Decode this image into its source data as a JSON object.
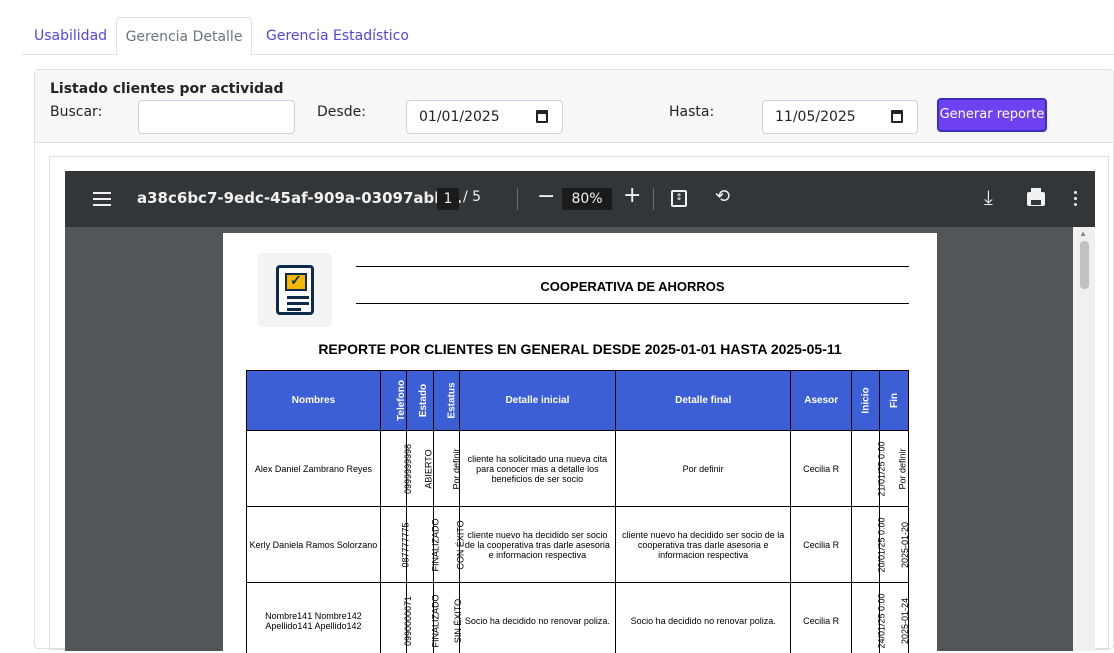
{
  "tabs": [
    {
      "label": "Usabilidad",
      "active": false
    },
    {
      "label": "Gerencia Detalle",
      "active": true
    },
    {
      "label": "Gerencia Estadístico",
      "active": false
    }
  ],
  "filter": {
    "title": "Listado clientes por actividad",
    "search_label": "Buscar:",
    "search_value": "",
    "from_label": "Desde:",
    "from_value": "01/01/2025",
    "to_label": "Hasta:",
    "to_value": "11/05/2025",
    "generate_button": "Generar reporte"
  },
  "pdf_viewer": {
    "doc_name": "a38c6bc7-9edc-45af-909a-03097abb...",
    "current_page": "1",
    "page_total": "/ 5",
    "zoom": "80%"
  },
  "report": {
    "org_name": "COOPERATIVA DE AHORROS",
    "title": "REPORTE POR CLIENTES EN GENERAL DESDE 2025-01-01 HASTA 2025-05-11",
    "columns": {
      "nombres": "Nombres",
      "telefono": "Telefono",
      "estado": "Estado",
      "estatus": "Estatus",
      "detalle_inicial": "Detalle inicial",
      "detalle_final": "Detalle final",
      "asesor": "Asesor",
      "inicio": "Inicio",
      "fin": "Fin"
    },
    "rows": [
      {
        "nombres": "Alex Daniel Zambrano Reyes",
        "telefono": "0999999998",
        "estado": "ABIERTO",
        "estatus": "Por definir",
        "detalle_inicial": "cliente ha solicitado una nueva cita para conocer mas a detalle los beneficios de ser socio",
        "detalle_final": "Por definir",
        "asesor": "Cecilia R",
        "inicio": "21/01/25 0:00",
        "fin": "Por definir"
      },
      {
        "nombres": "Kerly Daniela Ramos Solorzano",
        "telefono": "087777775",
        "estado": "FINALIZADO",
        "estatus": "CON ÉXITO",
        "detalle_inicial": "cliente nuevo ha decidido ser socio de la cooperativa tras darle asesoria e informacion respectiva",
        "detalle_final": "cliente nuevo ha decidido ser socio de la cooperativa tras darle asesoria e informacion respectiva",
        "asesor": "Cecilia R",
        "inicio": "20/01/25 0:00",
        "fin": "2025-01-20"
      },
      {
        "nombres": "Nombre141 Nombre142 Apellido141 Apellido142",
        "telefono": "0990000071",
        "estado": "FINALIZADO",
        "estatus": "SIN ÉXITO",
        "detalle_inicial": "Socio ha decidido no renovar poliza.",
        "detalle_final": "Socio ha decidido no renovar poliza.",
        "asesor": "Cecilia R",
        "inicio": "24/01/25 0:00",
        "fin": "2025-01-24"
      }
    ]
  }
}
